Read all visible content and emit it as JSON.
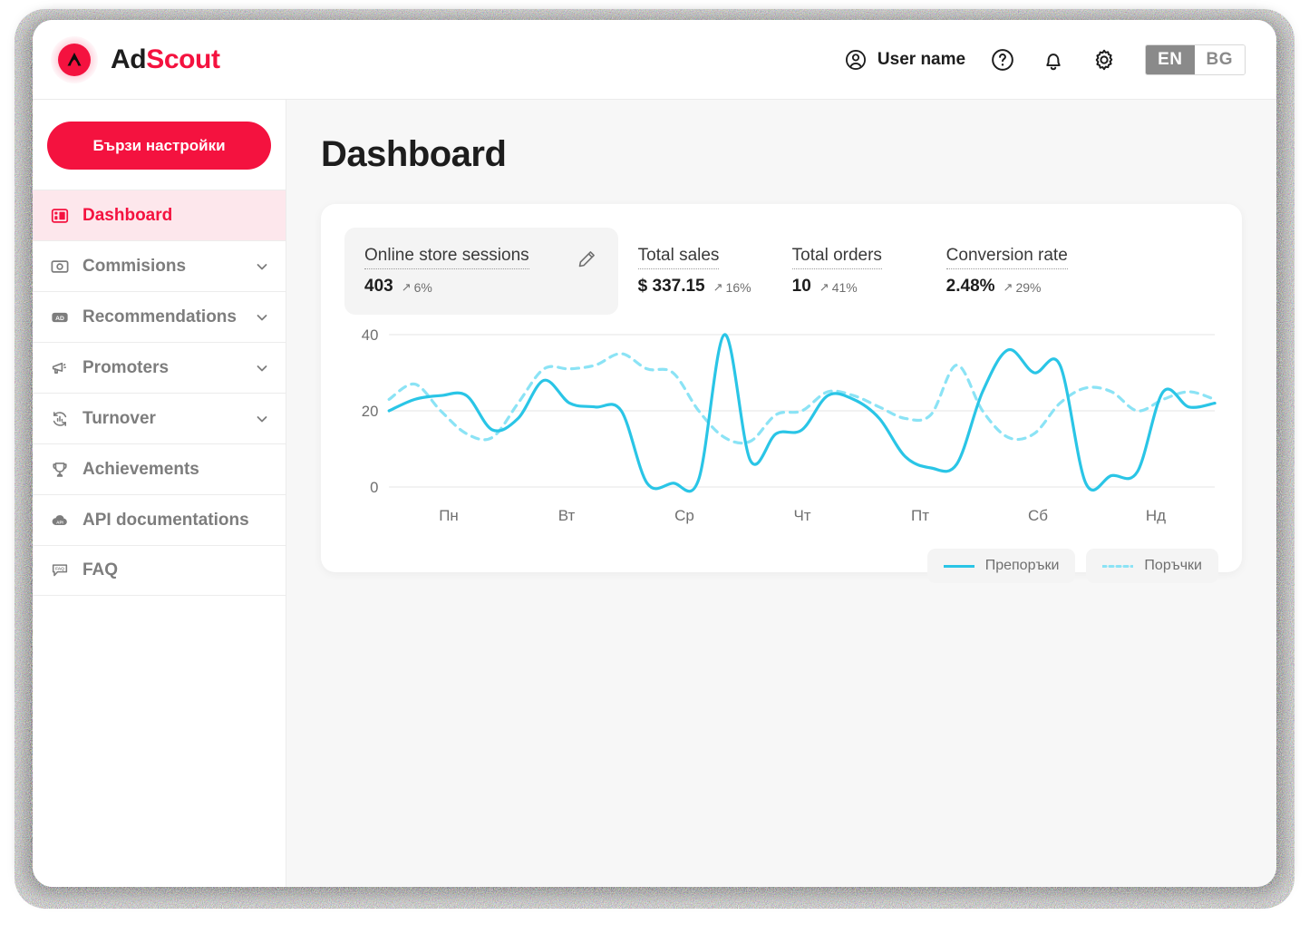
{
  "header": {
    "brand_ad": "Ad",
    "brand_scout": "Scout",
    "user_name": "User name",
    "help_icon": "question-circle-icon",
    "bell_icon": "bell-icon",
    "gear_icon": "gear-icon",
    "languages": [
      {
        "code": "EN",
        "active": true
      },
      {
        "code": "BG",
        "active": false
      }
    ]
  },
  "sidebar": {
    "quick_settings_label": "Бързи настройки",
    "items": [
      {
        "label": "Dashboard",
        "icon": "dashboard-icon",
        "active": true,
        "chevron": false
      },
      {
        "label": "Commisions",
        "icon": "banknote-icon",
        "active": false,
        "chevron": true
      },
      {
        "label": "Recommendations",
        "icon": "ad-badge-icon",
        "active": false,
        "chevron": true
      },
      {
        "label": "Promoters",
        "icon": "megaphone-icon",
        "active": false,
        "chevron": true
      },
      {
        "label": "Turnover",
        "icon": "refresh-chart-icon",
        "active": false,
        "chevron": true
      },
      {
        "label": "Achievements",
        "icon": "trophy-icon",
        "active": false,
        "chevron": false
      },
      {
        "label": "API documentations",
        "icon": "api-cloud-icon",
        "active": false,
        "chevron": false
      },
      {
        "label": "FAQ",
        "icon": "faq-bubble-icon",
        "active": false,
        "chevron": false
      }
    ]
  },
  "main": {
    "page_title": "Dashboard",
    "metrics": [
      {
        "label": "Online store sessions",
        "value": "403",
        "delta": "6%",
        "trend": "up",
        "selected": true,
        "edit_icon": "pencil-icon"
      },
      {
        "label": "Total sales",
        "value": "$ 337.15",
        "delta": "16%",
        "trend": "up",
        "selected": false
      },
      {
        "label": "Total orders",
        "value": "10",
        "delta": "41%",
        "trend": "up",
        "selected": false
      },
      {
        "label": "Conversion rate",
        "value": "2.48%",
        "delta": "29%",
        "trend": "up",
        "selected": false
      }
    ]
  },
  "chart_data": {
    "type": "line",
    "title": "",
    "xlabel": "",
    "ylabel": "",
    "categories": [
      "Пн",
      "Вт",
      "Ср",
      "Чт",
      "Пт",
      "Сб",
      "Нд"
    ],
    "ylim": [
      0,
      40
    ],
    "yticks": [
      0,
      20,
      40
    ],
    "grid": true,
    "legend_position": "bottom-right",
    "series": [
      {
        "name": "Препоръки",
        "style": "solid",
        "color": "#2AC5E6",
        "values": [
          20,
          23,
          24,
          24,
          15,
          18,
          28,
          22,
          21,
          20,
          1,
          1,
          2,
          40,
          7,
          14,
          15,
          24,
          23,
          18,
          8,
          5,
          6,
          25,
          36,
          30,
          32,
          1,
          3,
          4,
          25,
          21,
          22
        ]
      },
      {
        "name": "Поръчки",
        "style": "dashed",
        "color": "#8BE3F5",
        "values": [
          23,
          27,
          20,
          14,
          13,
          22,
          31,
          31,
          32,
          35,
          31,
          30,
          20,
          13,
          12,
          19,
          20,
          25,
          24,
          21,
          18,
          19,
          32,
          20,
          13,
          14,
          22,
          26,
          25,
          20,
          23,
          25,
          23
        ]
      }
    ]
  }
}
